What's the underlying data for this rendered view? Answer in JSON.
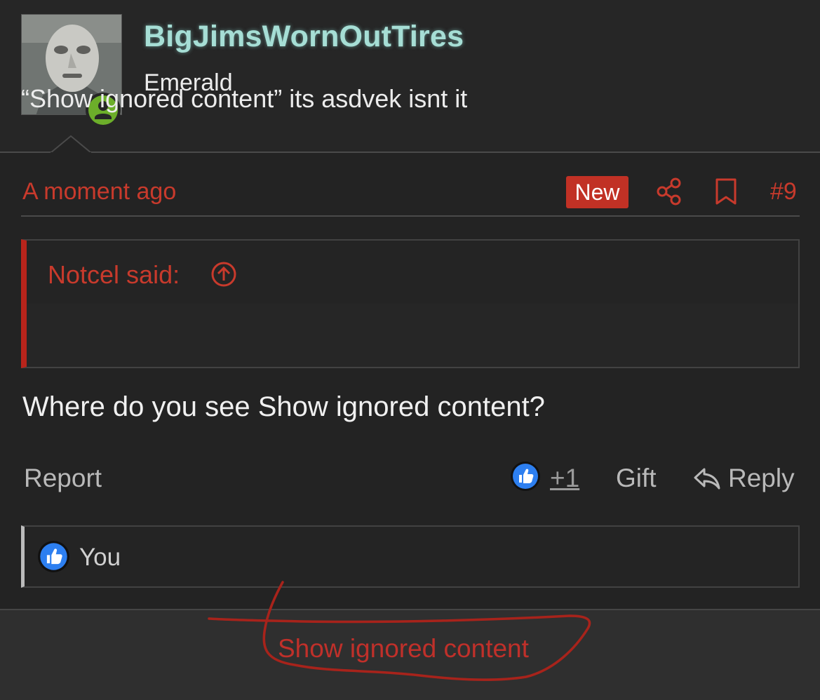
{
  "user": {
    "name": "BigJimsWornOutTires",
    "title": "Emerald"
  },
  "post": {
    "time": "A moment ago",
    "badge": "New",
    "number": "#9",
    "quote": {
      "author": "Notcel said:",
      "text": "“Show ignored content” its asdvek isnt it"
    },
    "message": "Where do you see Show ignored content?",
    "actions": {
      "report": "Report",
      "like_count": "+1",
      "gift": "Gift",
      "reply": "Reply"
    },
    "reactions": {
      "label": "You"
    }
  },
  "footer": {
    "show_ignored": "Show ignored content"
  },
  "colors": {
    "accent_red": "#c83a2c",
    "username": "#a6ded5",
    "online_green": "#6cae2a",
    "like_blue": "#2d7ff0"
  },
  "icons": [
    "share-icon",
    "bookmark-icon",
    "arrow-up-circle-icon",
    "like-icon",
    "reply-icon",
    "user-icon"
  ]
}
